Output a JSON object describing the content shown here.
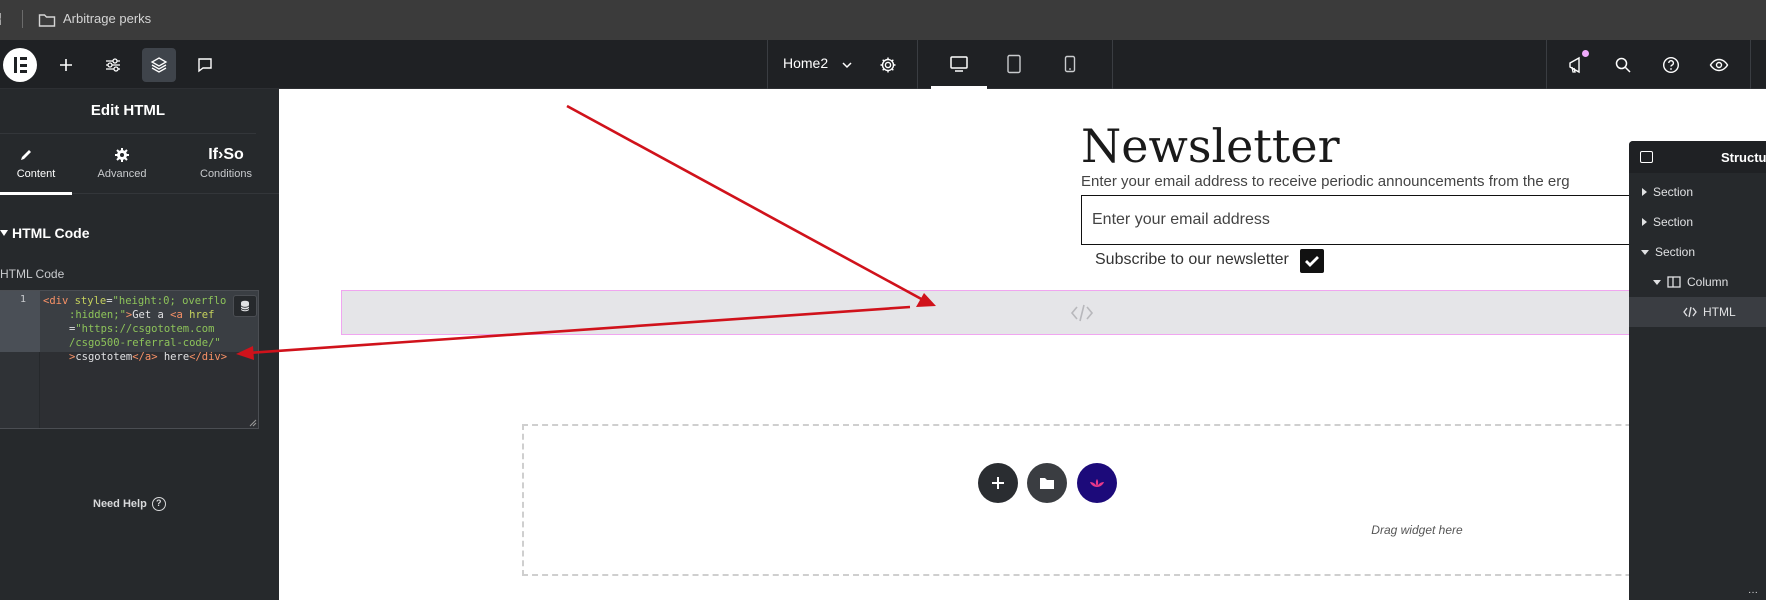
{
  "browser": {
    "breadcrumb": "Arbitrage perks"
  },
  "editor": {
    "page_name": "Home2"
  },
  "left_panel": {
    "title": "Edit HTML",
    "tabs": [
      {
        "label": "Content",
        "icon": "pencil-icon",
        "active": true
      },
      {
        "label": "Advanced",
        "icon": "gear-icon",
        "active": false
      },
      {
        "label": "Conditions",
        "icon": "ifso-icon",
        "brand": "If›So",
        "active": false
      }
    ],
    "section_title": "HTML Code",
    "field_label": "HTML Code",
    "code": {
      "line_number": "1",
      "lines": [
        [
          {
            "t": "tag",
            "v": "<div "
          },
          {
            "t": "attr",
            "v": "style"
          },
          {
            "t": "txt",
            "v": "="
          },
          {
            "t": "str",
            "v": "\"height:0; overflo"
          }
        ],
        [
          {
            "t": "str",
            "v": ":hidden;\""
          },
          {
            "t": "tag",
            "v": ">"
          },
          {
            "t": "txt",
            "v": "Get a "
          },
          {
            "t": "tag",
            "v": "<a "
          },
          {
            "t": "attr",
            "v": "href"
          }
        ],
        [
          {
            "t": "txt",
            "v": "="
          },
          {
            "t": "str",
            "v": "\"https://csgototem.com"
          }
        ],
        [
          {
            "t": "str",
            "v": "/csgo500-referral-code/\""
          }
        ],
        [
          {
            "t": "tag",
            "v": ">"
          },
          {
            "t": "txt",
            "v": "csgototem"
          },
          {
            "t": "tag",
            "v": "</a>"
          },
          {
            "t": "txt",
            "v": " here"
          },
          {
            "t": "tag",
            "v": "</div>"
          }
        ]
      ]
    },
    "need_help": "Need Help",
    "need_help_glyph": "?"
  },
  "canvas": {
    "newsletter_title": "Newsletter",
    "newsletter_desc": "Enter your email address to receive periodic announcements from the erg",
    "email_placeholder": "Enter your email address",
    "subscribe_label": "Subscribe to our newsletter",
    "drop_text": "Drag widget here"
  },
  "structure": {
    "title": "Structure",
    "items": [
      {
        "label": "Section",
        "expanded": false
      },
      {
        "label": "Section",
        "expanded": false
      },
      {
        "label": "Section",
        "expanded": true
      },
      {
        "label": "Column",
        "expanded": true
      },
      {
        "label": "HTML",
        "selected": true
      }
    ],
    "more": "···"
  },
  "colors": {
    "panel_bg": "#26292c",
    "topbar_bg": "#1f2124",
    "arrow": "#d0121b",
    "widget_border": "#f0a6f0",
    "elementskit_purple": "#1c0a7a"
  }
}
